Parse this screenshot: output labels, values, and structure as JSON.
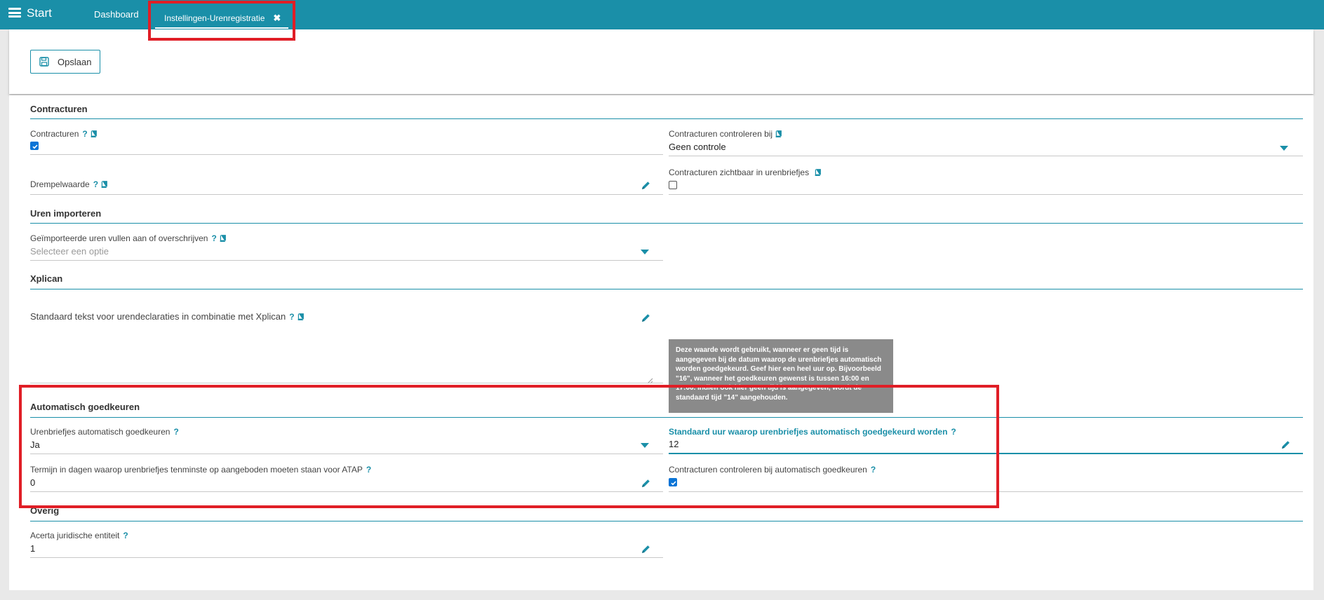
{
  "topbar": {
    "app_title": "Start",
    "tabs": [
      {
        "label": "Dashboard"
      },
      {
        "label": "Instellingen-Urenregistratie",
        "close": "✖"
      }
    ]
  },
  "toolbar": {
    "save_label": "Opslaan"
  },
  "sections": {
    "contracturen": {
      "title": "Contracturen",
      "contracturen": {
        "label": "Contracturen",
        "help": "?",
        "checked": true
      },
      "controleren_bij": {
        "label": "Contracturen controleren bij",
        "value": "Geen controle"
      },
      "drempelwaarde": {
        "label": "Drempelwaarde",
        "help": "?",
        "value": ""
      },
      "zichtbaar": {
        "label": "Contracturen zichtbaar in urenbriefjes",
        "checked": false
      }
    },
    "uren_importeren": {
      "title": "Uren importeren",
      "geimporteerde": {
        "label": "Geïmporteerde uren vullen aan of overschrijven",
        "help": "?",
        "placeholder": "Selecteer een optie"
      }
    },
    "xplican": {
      "title": "Xplican",
      "standaard_tekst": {
        "label": "Standaard tekst voor urendeclaraties in combinatie met Xplican",
        "help": "?",
        "value": ""
      }
    },
    "automatisch": {
      "title": "Automatisch goedkeuren",
      "urenbriefjes": {
        "label": "Urenbriefjes automatisch goedkeuren",
        "help": "?",
        "value": "Ja"
      },
      "standaard_uur": {
        "label": "Standaard uur waarop urenbriefjes automatisch goedgekeurd worden",
        "help": "?",
        "value": "12"
      },
      "termijn": {
        "label": "Termijn in dagen waarop urenbriefjes tenminste op aangeboden moeten staan voor ATAP",
        "help": "?",
        "value": "0"
      },
      "contracturen_auto": {
        "label": "Contracturen controleren bij automatisch goedkeuren",
        "help": "?",
        "checked": true
      }
    },
    "overig": {
      "title": "Overig",
      "acerta": {
        "label": "Acerta juridische entiteit",
        "help": "?",
        "value": "1"
      }
    }
  },
  "tooltip": {
    "text": "Deze waarde wordt gebruikt, wanneer er geen tijd is aangegeven bij de datum waarop de urenbriefjes automatisch worden goedgekeurd. Geef hier een heel uur op. Bijvoorbeeld \"16\", wanneer het goedkeuren gewenst is tussen 16:00 en 17:00. Indien ook hier geen tijd is aangegeven, wordt de standaard tijd \"14\" aangehouden."
  },
  "colors": {
    "accent": "#1a8fa8",
    "highlight": "#e01e26",
    "checkbox": "#0a74d6",
    "tooltip_bg": "#8a8a8a"
  }
}
